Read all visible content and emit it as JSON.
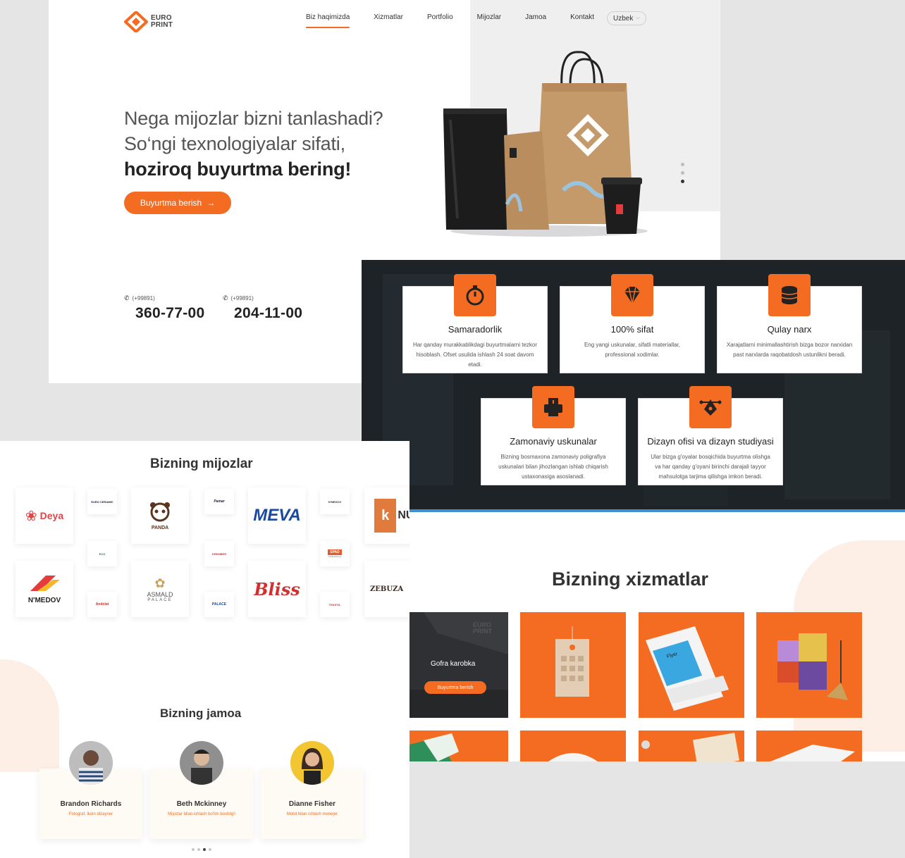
{
  "hero": {
    "logo_line1": "EURO",
    "logo_line2": "PRINT",
    "nav": [
      "Biz haqimizda",
      "Xizmatlar",
      "Portfolio",
      "Mijozlar",
      "Jamoa",
      "Kontakt"
    ],
    "language": "Uzbek",
    "title_line1": "Nega mijozlar bizni tanlashadi?",
    "title_line2": "So‘ngi texnologiyalar sifati,",
    "title_line3": "hoziroq buyurtma bering!",
    "cta": "Buyurtma berish",
    "phones": [
      {
        "code": "(+99891)",
        "number": "360-77-00"
      },
      {
        "code": "(+99891)",
        "number": "204-11-00"
      }
    ]
  },
  "features": [
    {
      "title": "Samaradorlik",
      "desc": "Har qanday murakkablikdagi buyurtmalarni tezkor hisoblash. Ofset usulida ishlash 24 soat davom etadi.",
      "icon": "stopwatch-icon"
    },
    {
      "title": "100% sifat",
      "desc": "Eng yangi uskunalar, sifatli materiallar, professional xodimlar.",
      "icon": "diamond-icon"
    },
    {
      "title": "Qulay narx",
      "desc": "Xarajatlarni minimallashtirish bizga bozor narxidan past narxlarda raqobatdosh ustunlikni beradi.",
      "icon": "coins-icon"
    },
    {
      "title": "Zamonaviy uskunalar",
      "desc": "Bizning bosmaxona zamonaviy poligrafiya uskunalari bilan jihozlangan ishlab chiqarish ustaxonasiga asoslanadi.",
      "icon": "printer-icon"
    },
    {
      "title": "Dizayn ofisi va dizayn studiyasi",
      "desc": "Ular bizga g'oyalar bosqichida buyurtma olishga va har qanday g'oyani birinchi darajali tayyor mahsulotga tarjima qilishga imkon beradi.",
      "icon": "pen-tool-icon"
    }
  ],
  "clients": {
    "title": "Bizning mijozlar",
    "logos": [
      "Deya",
      "EURO CERAMIC",
      "PANDA",
      "Pamar",
      "MEVA",
      "N'MEDOV",
      "NUR",
      "N'MEDOV",
      "ECO",
      "ASMALD",
      "PALACE",
      "KREMBER",
      "Bliss",
      "SPAD",
      "Confectionery",
      "Andolat",
      "ZEBUZA",
      "PALACE",
      "TEKSTIL"
    ]
  },
  "team": {
    "title": "Bizning jamoa",
    "members": [
      {
        "name": "Brandon Richards",
        "role": "Fotograf, lkoin dizayner"
      },
      {
        "name": "Beth Mckinney",
        "role": "Mijozlar bilan ishlash bo'lim boshlig'i"
      },
      {
        "name": "Dianne Fisher",
        "role": "Mobil bilan ishlash menejer"
      }
    ]
  },
  "services": {
    "title": "Bizning xizmatlar",
    "first_label": "Gofra karobka",
    "first_button": "Buyurtma berish",
    "box_logo": "EURO PRINT",
    "flyer_label": "Flyer"
  },
  "colors": {
    "accent": "#f36c21",
    "dark": "#1d2327",
    "peach": "#fdeee6"
  }
}
